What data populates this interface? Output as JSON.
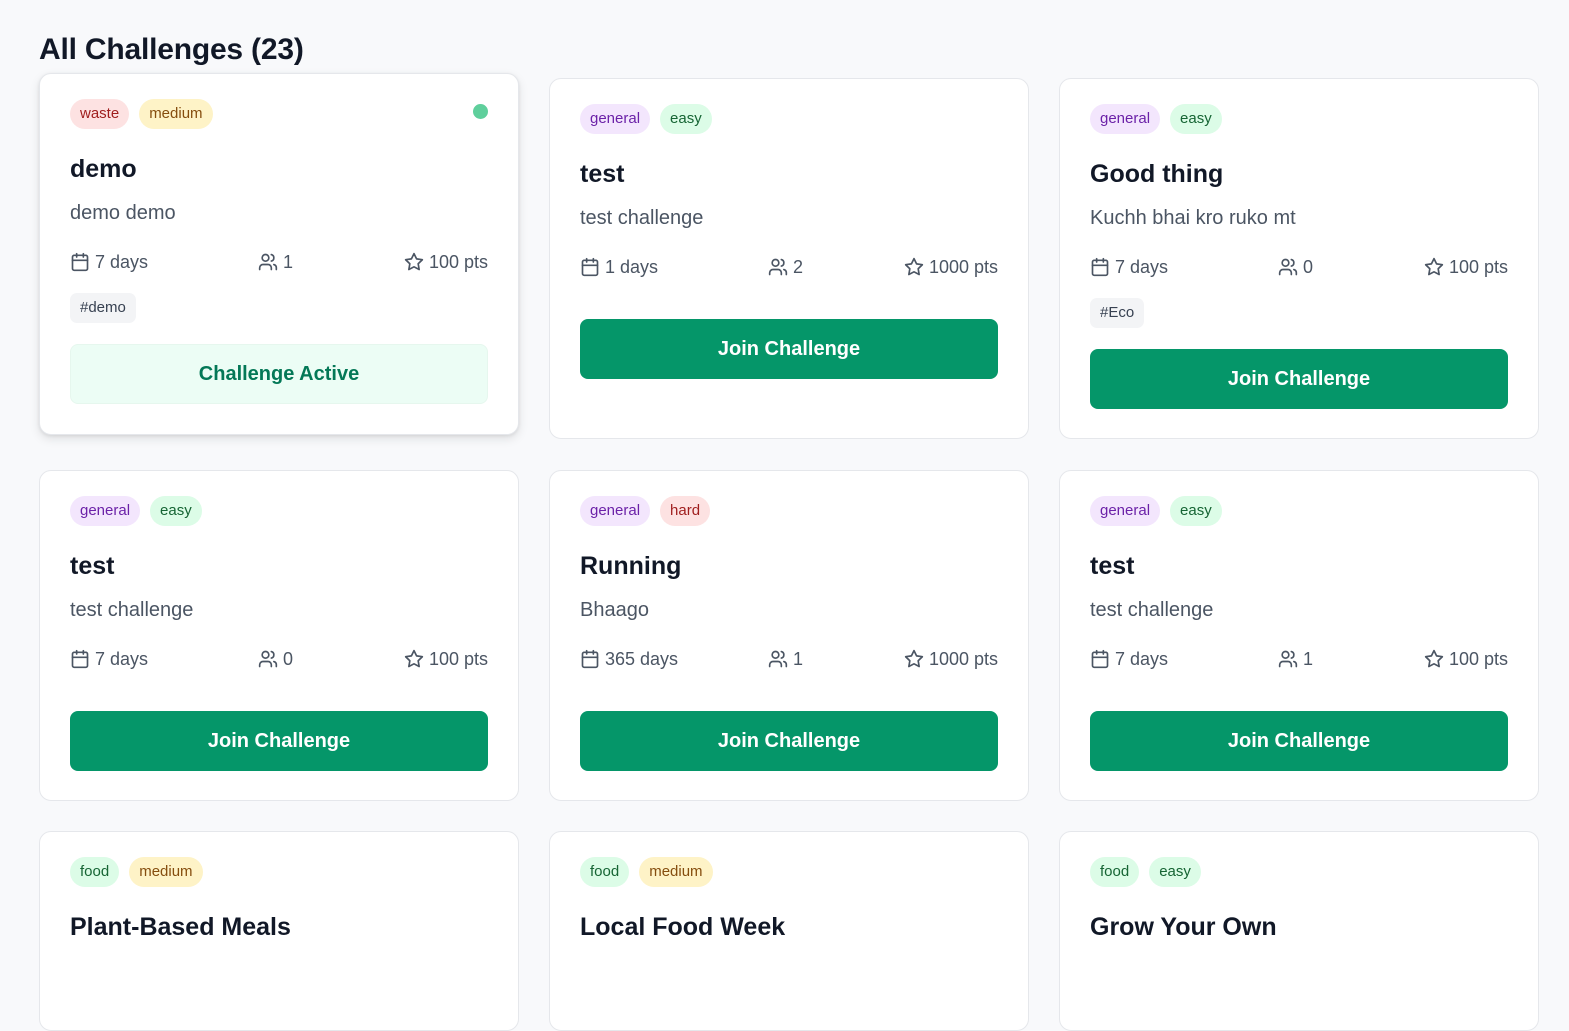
{
  "page": {
    "title": "All Challenges (23)"
  },
  "colors": {
    "accent": "#059669",
    "active_bg": "#ecfdf5",
    "status_dot": "#5fcf9c"
  },
  "icons": {
    "days": "calendar-icon",
    "participants": "users-icon",
    "points": "star-icon"
  },
  "cards": [
    {
      "category": "waste",
      "difficulty": "medium",
      "title": "demo",
      "description": "demo demo",
      "days": "7 days",
      "participants": "1",
      "points": "100 pts",
      "tag": "#demo",
      "button": "Challenge Active",
      "state": "active"
    },
    {
      "category": "general",
      "difficulty": "easy",
      "title": "test",
      "description": "test challenge",
      "days": "1 days",
      "participants": "2",
      "points": "1000 pts",
      "button": "Join Challenge",
      "state": "join"
    },
    {
      "category": "general",
      "difficulty": "easy",
      "title": "Good thing",
      "description": "Kuchh bhai kro ruko mt",
      "days": "7 days",
      "participants": "0",
      "points": "100 pts",
      "tag": "#Eco",
      "button": "Join Challenge",
      "state": "join"
    },
    {
      "category": "general",
      "difficulty": "easy",
      "title": "test",
      "description": "test challenge",
      "days": "7 days",
      "participants": "0",
      "points": "100 pts",
      "button": "Join Challenge",
      "state": "join"
    },
    {
      "category": "general",
      "difficulty": "hard",
      "title": "Running",
      "description": "Bhaago",
      "days": "365 days",
      "participants": "1",
      "points": "1000 pts",
      "button": "Join Challenge",
      "state": "join"
    },
    {
      "category": "general",
      "difficulty": "easy",
      "title": "test",
      "description": "test challenge",
      "days": "7 days",
      "participants": "1",
      "points": "100 pts",
      "button": "Join Challenge",
      "state": "join"
    },
    {
      "category": "food",
      "difficulty": "medium",
      "title": "Plant-Based Meals"
    },
    {
      "category": "food",
      "difficulty": "medium",
      "title": "Local Food Week"
    },
    {
      "category": "food",
      "difficulty": "easy",
      "title": "Grow Your Own"
    }
  ]
}
